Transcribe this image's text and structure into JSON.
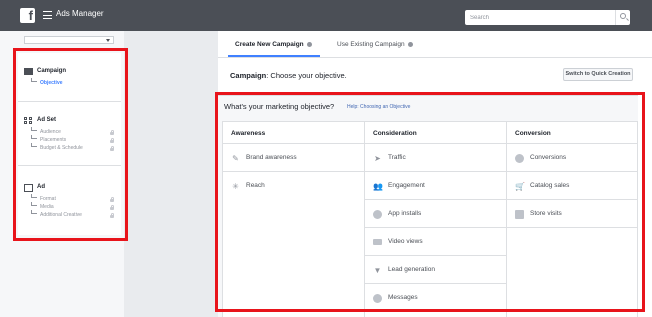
{
  "topbar": {
    "app_title": "Ads Manager",
    "search_placeholder": "Search"
  },
  "sidebar": {
    "sections": [
      {
        "title": "Campaign",
        "items": [
          {
            "label": "Objective",
            "active": true
          }
        ]
      },
      {
        "title": "Ad Set",
        "items": [
          {
            "label": "Audience"
          },
          {
            "label": "Placements"
          },
          {
            "label": "Budget & Schedule"
          }
        ]
      },
      {
        "title": "Ad",
        "items": [
          {
            "label": "Format"
          },
          {
            "label": "Media"
          },
          {
            "label": "Additional Creative"
          }
        ]
      }
    ]
  },
  "main": {
    "tabs": [
      {
        "label": "Create New Campaign",
        "active": true
      },
      {
        "label": "Use Existing Campaign"
      }
    ],
    "objective_label": "Campaign",
    "objective_text": ": Choose your objective.",
    "quick_creation_label": "Switch to Quick Creation",
    "objective_panel": {
      "heading": "What's your marketing objective?",
      "help_link": "Help: Choosing an Objective",
      "columns": [
        {
          "title": "Awareness",
          "items": [
            {
              "label": "Brand awareness",
              "icon": "megaphone-icon"
            },
            {
              "label": "Reach",
              "icon": "reach-icon"
            }
          ]
        },
        {
          "title": "Consideration",
          "items": [
            {
              "label": "Traffic",
              "icon": "cursor-icon"
            },
            {
              "label": "Engagement",
              "icon": "people-icon"
            },
            {
              "label": "App installs",
              "icon": "app-icon"
            },
            {
              "label": "Video views",
              "icon": "video-icon"
            },
            {
              "label": "Lead generation",
              "icon": "funnel-icon"
            },
            {
              "label": "Messages",
              "icon": "chat-icon"
            }
          ]
        },
        {
          "title": "Conversion",
          "items": [
            {
              "label": "Conversions",
              "icon": "globe-icon"
            },
            {
              "label": "Catalog sales",
              "icon": "cart-icon"
            },
            {
              "label": "Store visits",
              "icon": "store-icon"
            }
          ]
        }
      ]
    }
  },
  "colors": {
    "highlight": "#e8141b",
    "accent": "#4080ff",
    "topbar": "#4b4f56"
  }
}
